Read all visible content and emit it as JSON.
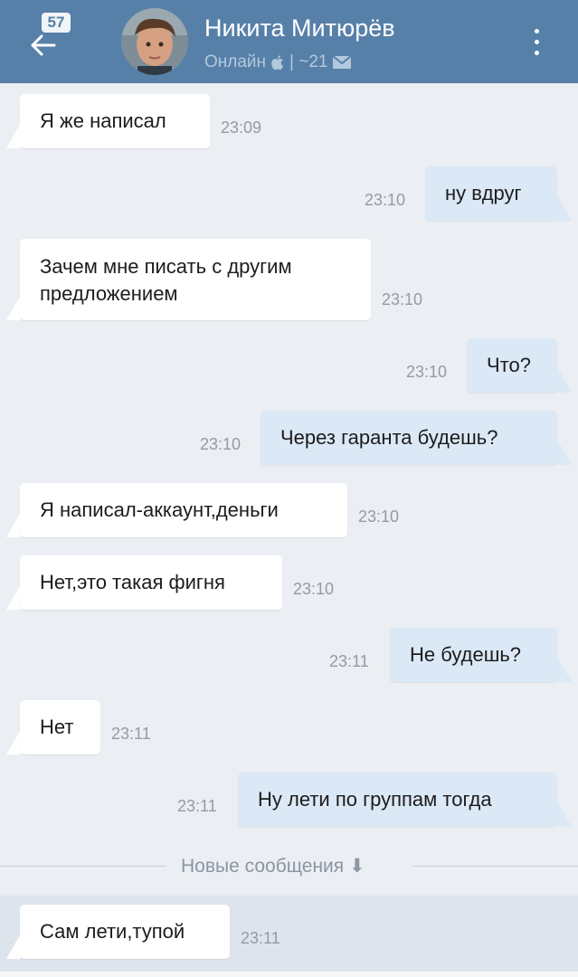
{
  "header": {
    "unread_count": "57",
    "contact_name": "Никита Митюрёв",
    "status": "Онлайн",
    "status_extra": "| ~21",
    "colors": {
      "bar": "#5780a9",
      "incoming": "#ffffff",
      "outgoing": "#dbe8f6"
    }
  },
  "messages": [
    {
      "dir": "in",
      "text": "Я же написал",
      "time": "23:09"
    },
    {
      "dir": "out",
      "text": "ну вдруг",
      "time": "23:10"
    },
    {
      "dir": "in",
      "line1": "Зачем мне писать с другим",
      "line2": "предложением",
      "time": "23:10"
    },
    {
      "dir": "out",
      "text": "Что?",
      "time": "23:10"
    },
    {
      "dir": "out",
      "text": "Через гаранта будешь?",
      "time": "23:10"
    },
    {
      "dir": "in",
      "text": "Я написал-аккаунт,деньги",
      "time": "23:10"
    },
    {
      "dir": "in",
      "text": "Нет,это такая фигня",
      "time": "23:10"
    },
    {
      "dir": "out",
      "text": "Не будешь?",
      "time": "23:11"
    },
    {
      "dir": "in",
      "text": "Нет",
      "time": "23:11"
    },
    {
      "dir": "out",
      "text": "Ну лети по группам тогда",
      "time": "23:11"
    },
    {
      "dir": "in",
      "text": "Сам лети,тупой",
      "time": "23:11"
    }
  ],
  "divider": {
    "label": "Новые сообщения ⬇"
  },
  "icons": [
    "back-arrow-icon",
    "apple-icon",
    "envelope-icon",
    "more-vertical-icon",
    "down-arrow-icon"
  ]
}
